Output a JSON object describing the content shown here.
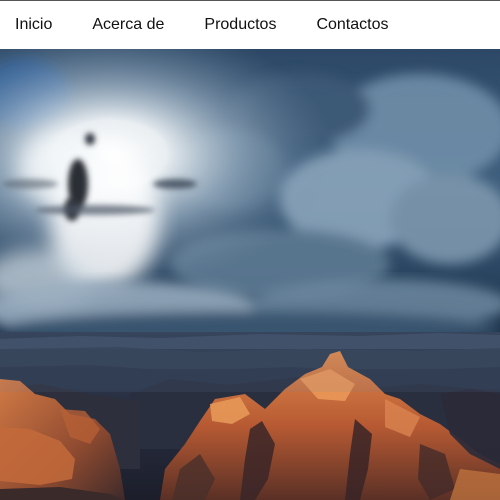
{
  "nav": {
    "items": [
      {
        "label": "Inicio"
      },
      {
        "label": "Acerca de"
      },
      {
        "label": "Productos"
      },
      {
        "label": "Contactos"
      }
    ]
  },
  "hero": {
    "image": "grand-canyon-storm-landscape"
  },
  "colors": {
    "nav_background": "#ffffff",
    "nav_text": "#111111",
    "sky_dark": "#1e3a58",
    "sky_light": "#eef3f7",
    "rock_lit": "#c8683a",
    "rock_shadow": "#3a2c2a"
  }
}
